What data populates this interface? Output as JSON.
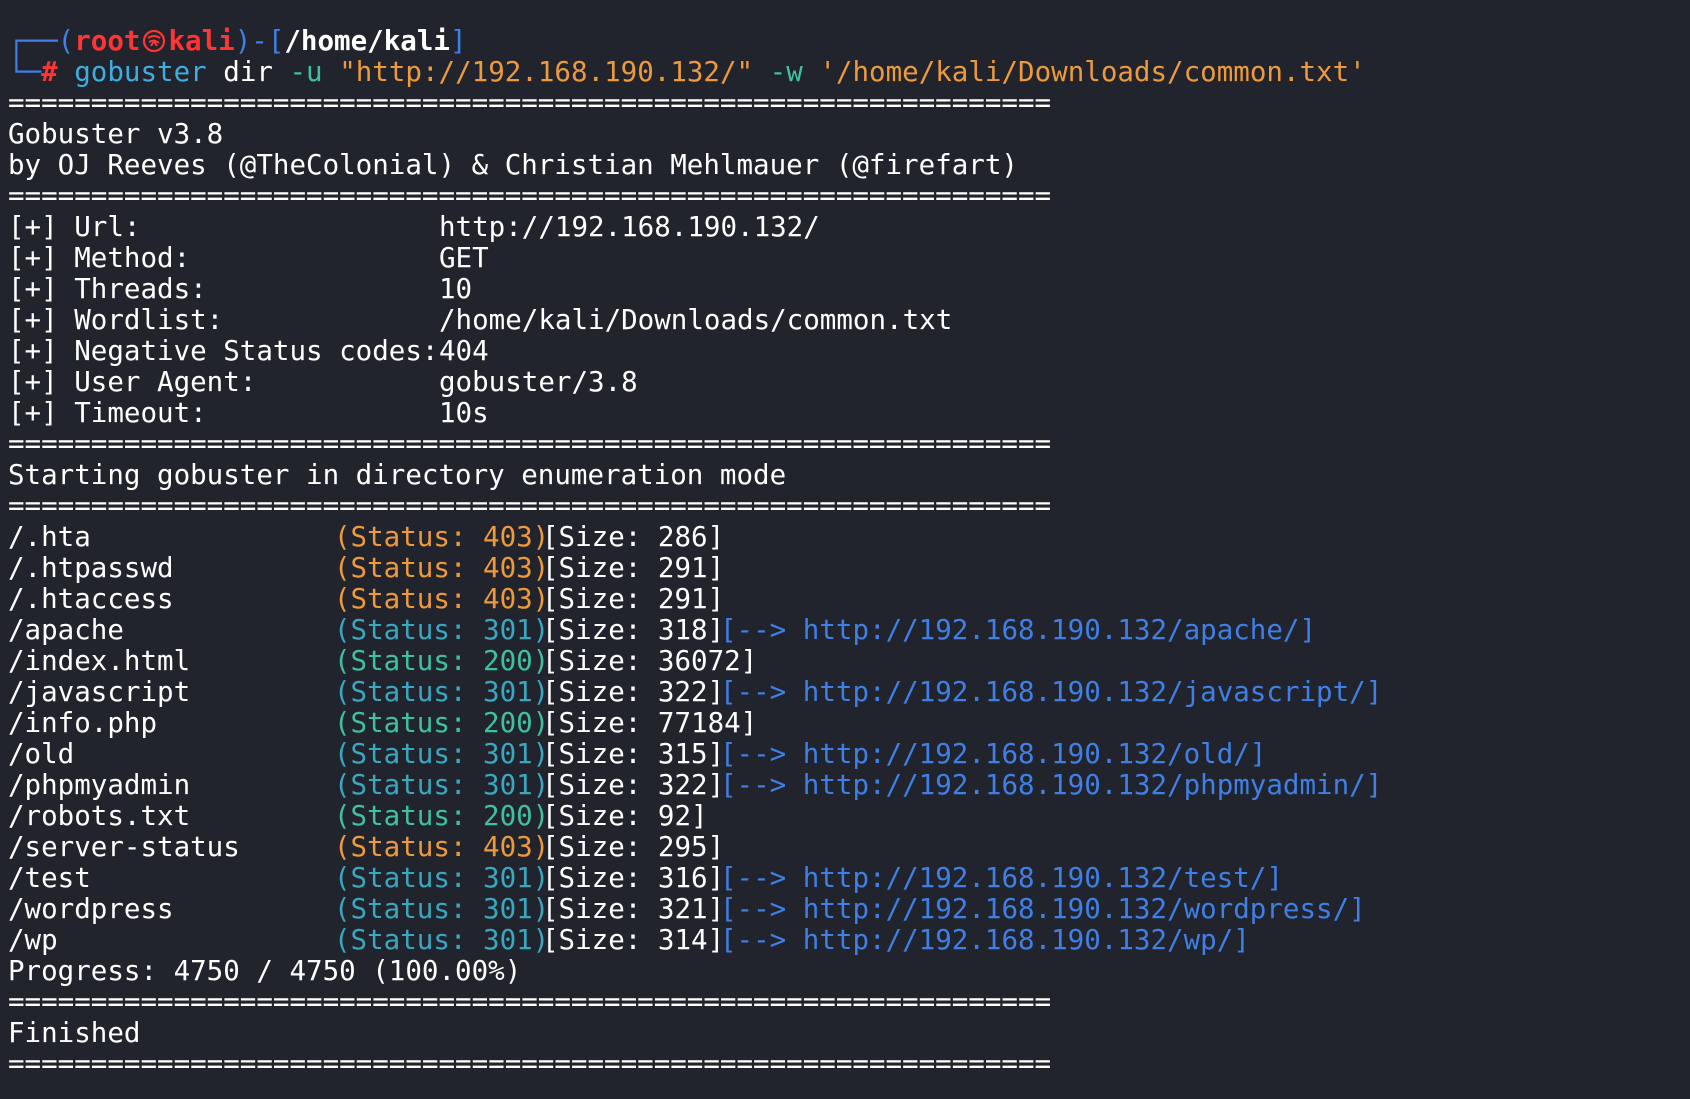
{
  "prompt": {
    "open": "┌──(",
    "user": "root",
    "host": "kali",
    "mid": ")-[",
    "path": "/home/kali",
    "close": "]",
    "corner": "└─",
    "hash": "#",
    "cmd": "gobuster",
    "sub": "dir",
    "flag_u": "-u",
    "url_arg": "\"http://192.168.190.132/\"",
    "flag_w": "-w",
    "wordlist_arg": "'/home/kali/Downloads/common.txt'"
  },
  "separator": "===============================================================",
  "banner": {
    "version": "Gobuster v3.8",
    "authors": "by OJ Reeves (@TheColonial) & Christian Mehlmauer (@firefart)"
  },
  "config": [
    {
      "key": "[+] Url:",
      "value": "http://192.168.190.132/"
    },
    {
      "key": "[+] Method:",
      "value": "GET"
    },
    {
      "key": "[+] Threads:",
      "value": "10"
    },
    {
      "key": "[+] Wordlist:",
      "value": "/home/kali/Downloads/common.txt"
    },
    {
      "key": "[+] Negative Status codes:",
      "value": "404"
    },
    {
      "key": "[+] User Agent:",
      "value": "gobuster/3.8"
    },
    {
      "key": "[+] Timeout:",
      "value": "10s"
    }
  ],
  "start_message": "Starting gobuster in directory enumeration mode",
  "results": [
    {
      "path": "/.hta",
      "status": "(Status: 403)",
      "code": "403",
      "size": "[Size: 286]",
      "redirect": ""
    },
    {
      "path": "/.htpasswd",
      "status": "(Status: 403)",
      "code": "403",
      "size": "[Size: 291]",
      "redirect": ""
    },
    {
      "path": "/.htaccess",
      "status": "(Status: 403)",
      "code": "403",
      "size": "[Size: 291]",
      "redirect": ""
    },
    {
      "path": "/apache",
      "status": "(Status: 301)",
      "code": "301",
      "size": "[Size: 318]",
      "redirect": "[--> http://192.168.190.132/apache/]"
    },
    {
      "path": "/index.html",
      "status": "(Status: 200)",
      "code": "200",
      "size": "[Size: 36072]",
      "redirect": ""
    },
    {
      "path": "/javascript",
      "status": "(Status: 301)",
      "code": "301",
      "size": "[Size: 322]",
      "redirect": "[--> http://192.168.190.132/javascript/]"
    },
    {
      "path": "/info.php",
      "status": "(Status: 200)",
      "code": "200",
      "size": "[Size: 77184]",
      "redirect": ""
    },
    {
      "path": "/old",
      "status": "(Status: 301)",
      "code": "301",
      "size": "[Size: 315]",
      "redirect": "[--> http://192.168.190.132/old/]"
    },
    {
      "path": "/phpmyadmin",
      "status": "(Status: 301)",
      "code": "301",
      "size": "[Size: 322]",
      "redirect": "[--> http://192.168.190.132/phpmyadmin/]"
    },
    {
      "path": "/robots.txt",
      "status": "(Status: 200)",
      "code": "200",
      "size": "[Size: 92]",
      "redirect": ""
    },
    {
      "path": "/server-status",
      "status": "(Status: 403)",
      "code": "403",
      "size": "[Size: 295]",
      "redirect": ""
    },
    {
      "path": "/test",
      "status": "(Status: 301)",
      "code": "301",
      "size": "[Size: 316]",
      "redirect": "[--> http://192.168.190.132/test/]"
    },
    {
      "path": "/wordpress",
      "status": "(Status: 301)",
      "code": "301",
      "size": "[Size: 321]",
      "redirect": "[--> http://192.168.190.132/wordpress/]"
    },
    {
      "path": "/wp",
      "status": "(Status: 301)",
      "code": "301",
      "size": "[Size: 314]",
      "redirect": "[--> http://192.168.190.132/wp/]"
    }
  ],
  "progress": "Progress: 4750 / 4750 (100.00%)",
  "finished": "Finished",
  "colors": {
    "background": "#21242c",
    "text": "#ffffff",
    "status_403": "#ee9a3c",
    "status_301": "#3aa7c0",
    "status_200": "#3fc1a0",
    "redirect_link": "#3f7fe6",
    "prompt_frame": "#3f7fe6",
    "prompt_user": "#ff3535"
  },
  "icons": {
    "prompt_separator": "kali-skull-icon"
  }
}
